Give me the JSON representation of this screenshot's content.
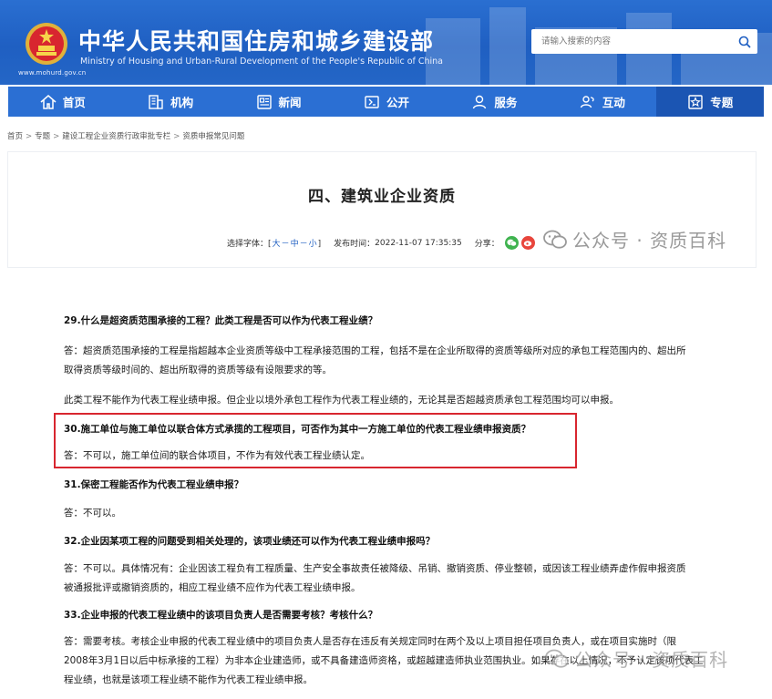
{
  "site": {
    "url": "www.mohurd.gov.cn",
    "title": "中华人民共和国住房和城乡建设部",
    "subtitle": "Ministry of Housing and Urban-Rural Development of the People's Republic of China",
    "search_placeholder": "请输入搜索的内容"
  },
  "nav": [
    {
      "label": "首页",
      "icon": "home-icon"
    },
    {
      "label": "机构",
      "icon": "building-icon"
    },
    {
      "label": "新闻",
      "icon": "news-icon"
    },
    {
      "label": "公开",
      "icon": "disclosure-icon"
    },
    {
      "label": "服务",
      "icon": "service-icon"
    },
    {
      "label": "互动",
      "icon": "interaction-icon"
    },
    {
      "label": "专题",
      "icon": "topic-icon"
    }
  ],
  "breadcrumb": [
    "首页",
    "专题",
    "建设工程企业资质行政审批专栏",
    "资质申报常见问题"
  ],
  "article": {
    "title": "四、建筑业企业资质",
    "font_label": "选择字体：",
    "font_open": "[",
    "font_large": "大",
    "font_medium": "中",
    "font_small": "小",
    "font_close": "]",
    "font_sep": "－",
    "time_label": "发布时间：",
    "time": "2022-11-07 17:35:35",
    "share_label": "分享："
  },
  "watermark": {
    "text": "公众号 · 资质百科"
  },
  "qa": {
    "q29": "29.什么是超资质范围承接的工程？此类工程是否可以作为代表工程业绩？",
    "a29_line1": "答：超资质范围承接的工程是指超越本企业资质等级中工程承接范围的工程，包括不是在企业所取得的资质等级所对应的承包工程范围内的、超出所",
    "a29_line2": "取得资质等级时间的、超出所取得的资质等级有设限要求的等。",
    "a29_p2": "此类工程不能作为代表工程业绩申报。但企业以境外承包工程作为代表工程业绩的，无论其是否超越资质承包工程范围均可以申报。",
    "q30": "30.施工单位与施工单位以联合体方式承揽的工程项目，可否作为其中一方施工单位的代表工程业绩申报资质？",
    "a30": "答：不可以，施工单位间的联合体项目，不作为有效代表工程业绩认定。",
    "q31": "31.保密工程能否作为代表工程业绩申报？",
    "a31": "答：不可以。",
    "q32": "32.企业因某项工程的问题受到相关处理的，该项业绩还可以作为代表工程业绩申报吗？",
    "a32_line1": "答：不可以。具体情况有：企业因该工程负有工程质量、生产安全事故责任被降级、吊销、撤销资质、停业整顿，或因该工程业绩弄虚作假申报资质",
    "a32_line2": "被通报批评或撤销资质的，相应工程业绩不应作为代表工程业绩申报。",
    "q33": "33.企业申报的代表工程业绩中的该项目负责人是否需要考核？考核什么？",
    "a33_line1": "答：需要考核。考核企业申报的代表工程业绩中的项目负责人是否存在违反有关规定同时在两个及以上项目担任项目负责人，或在项目实施时（限",
    "a33_line2": "2008年3月1日以后中标承接的工程）为非本企业建造师，或不具备建造师资格，或超越建造师执业范围执业。如果存在以上情况，不予认定该项代表工",
    "a33_line3": "程业绩，也就是该项工程业绩不能作为代表工程业绩申报。"
  },
  "colors": {
    "header_blue": "#2a6fd1",
    "nav_blue": "#2b6fd3",
    "nav_active": "#1b55b3",
    "highlight_red": "#d8262f",
    "link_blue": "#1f5fc2"
  }
}
